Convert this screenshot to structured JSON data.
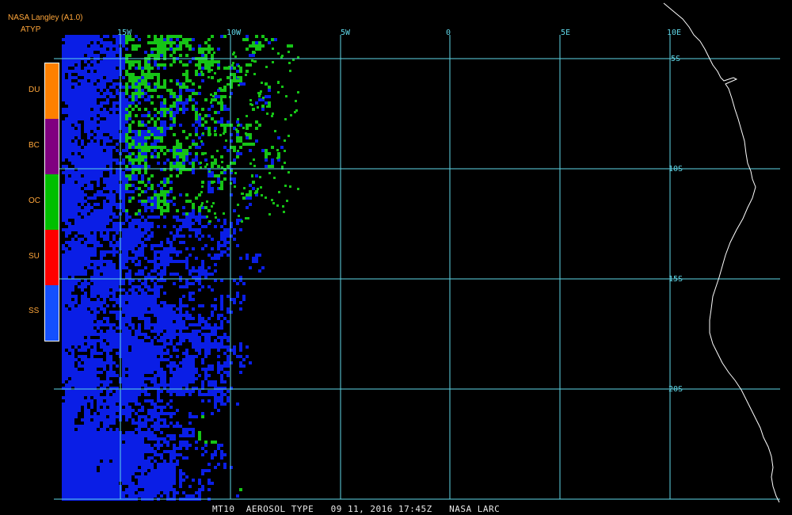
{
  "header": {
    "source": "NASA Langley (A1.0)",
    "product_code": "ATYP"
  },
  "legend": {
    "items": [
      {
        "label": "DU",
        "color": "#ff8000"
      },
      {
        "label": "BC",
        "color": "#800080"
      },
      {
        "label": "OC",
        "color": "#00bf00"
      },
      {
        "label": "SU",
        "color": "#ff0000"
      },
      {
        "label": "SS",
        "color": "#1450ff"
      }
    ]
  },
  "map": {
    "longitude_labels": [
      "15W",
      "10W",
      "5W",
      "0",
      "5E",
      "10E"
    ],
    "latitude_labels": [
      "5S",
      "10S",
      "15S",
      "20S"
    ],
    "gridline_color": "#5fd7e8",
    "coastline_color": "#ffffff",
    "aerosol_colors": {
      "sea_salt": "#0a1ee6",
      "organic_carbon": "#16c416"
    }
  },
  "footer": {
    "caption": "MT10  AEROSOL TYPE   09 11, 2016 17:45Z   NASA LARC"
  }
}
